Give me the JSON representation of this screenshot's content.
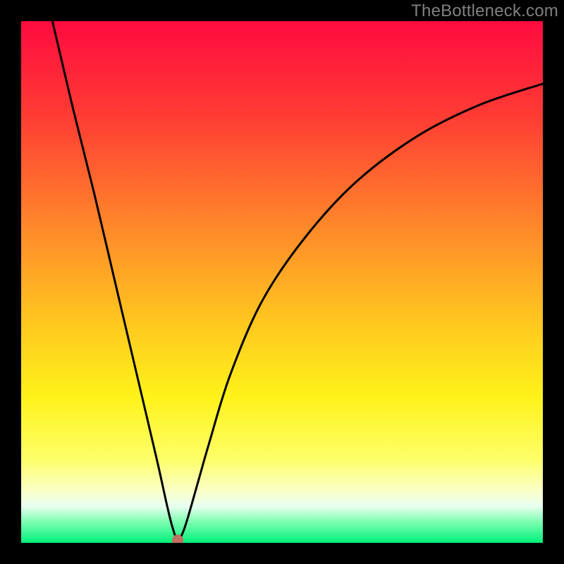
{
  "watermark": "TheBottleneck.com",
  "marker": {
    "color": "#c07060",
    "radius_px": 8
  },
  "chart_data": {
    "type": "line",
    "title": "",
    "xlabel": "",
    "ylabel": "",
    "xlim": [
      0,
      100
    ],
    "ylim": [
      0,
      100
    ],
    "gradient_stops": [
      {
        "pct": 0,
        "color": "#ff0b3f"
      },
      {
        "pct": 18,
        "color": "#ff3b34"
      },
      {
        "pct": 40,
        "color": "#ff8a2a"
      },
      {
        "pct": 58,
        "color": "#ffc81f"
      },
      {
        "pct": 72,
        "color": "#fff21a"
      },
      {
        "pct": 84,
        "color": "#fdff68"
      },
      {
        "pct": 90,
        "color": "#faffc8"
      },
      {
        "pct": 93,
        "color": "#e8fff0"
      },
      {
        "pct": 96,
        "color": "#7cffb0"
      },
      {
        "pct": 100,
        "color": "#00f07a"
      }
    ],
    "series": [
      {
        "name": "bottleneck-curve",
        "x": [
          6,
          10,
          14,
          18,
          22,
          26,
          28,
          29,
          30,
          31,
          32,
          34,
          36,
          40,
          46,
          54,
          64,
          76,
          88,
          100
        ],
        "y": [
          100,
          83,
          67,
          50,
          33,
          16,
          7,
          3,
          0.5,
          2,
          5,
          12,
          19,
          32,
          46,
          58,
          69,
          78,
          84,
          88
        ]
      }
    ],
    "marker_point": {
      "x": 30,
      "y": 0.5
    },
    "gridlines": false,
    "legend": false
  }
}
